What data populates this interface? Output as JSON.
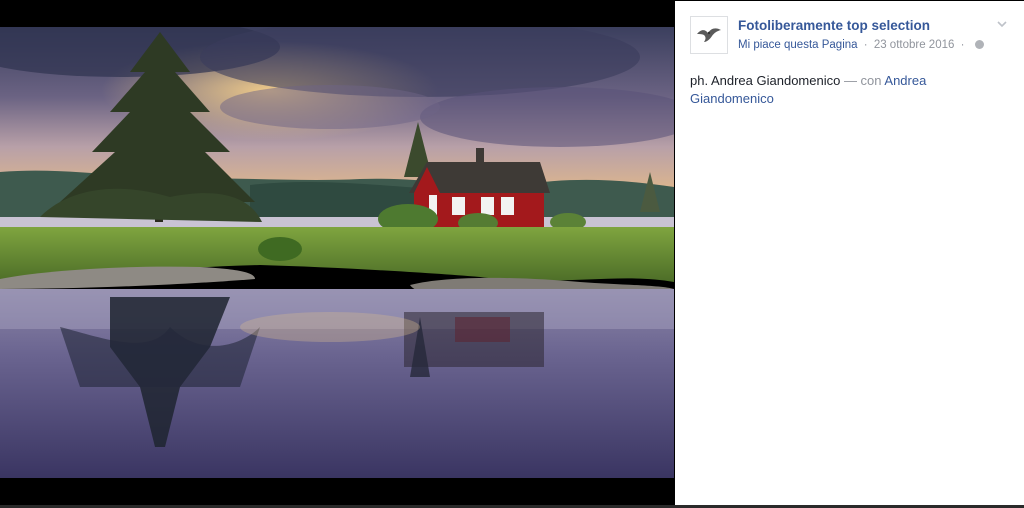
{
  "post": {
    "page_name": "Fotoliberamente top selection",
    "like_page": "Mi piace questa Pagina",
    "separator": "·",
    "date": "23 ottobre 2016",
    "separator2": "·",
    "privacy_icon": "globe-icon",
    "options_icon": "chevron-down-icon",
    "avatar_icon": "bird-logo-icon"
  },
  "caption": {
    "text": "ph. Andrea Giandomenico",
    "with": " — con ",
    "tagged": "Andrea Giandomenico"
  },
  "photo": {
    "subject": "landscape-photo"
  },
  "colors": {
    "link": "#365899",
    "meta": "#90949c",
    "text": "#1d2129"
  }
}
